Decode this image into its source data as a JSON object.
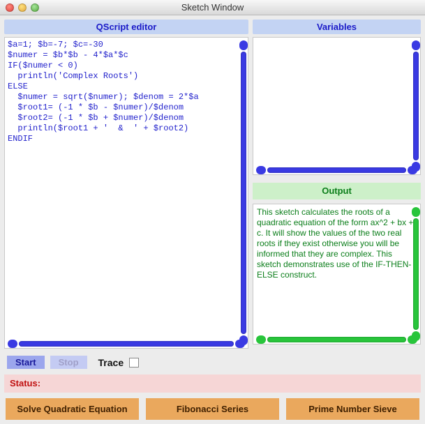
{
  "window": {
    "title": "Sketch Window"
  },
  "headers": {
    "editor": "QScript editor",
    "variables": "Variables",
    "output": "Output"
  },
  "editor_code": "$a=1; $b=-7; $c=-30\n$numer = $b*$b - 4*$a*$c\nIF($numer < 0)\n  println('Complex Roots')\nELSE\n  $numer = sqrt($numer); $denom = 2*$a\n  $root1= (-1 * $b - $numer)/$denom\n  $root2= (-1 * $b + $numer)/$denom\n  println($root1 + '  &  ' + $root2)\nENDIF",
  "output_text": "This sketch calculates the roots of a quadratic equation of the form ax^2 + bx + c. It will show the values of the two real roots if they exist otherwise you will  be informed that they are complex. This sketch demonstrates use of the IF-THEN-ELSE construct.",
  "controls": {
    "start": "Start",
    "stop": "Stop",
    "trace": "Trace"
  },
  "status": {
    "label": "Status:",
    "value": ""
  },
  "buttons": {
    "b1": "Solve Quadratic Equation",
    "b2": "Fibonacci Series",
    "b3": "Prime Number Sieve"
  }
}
